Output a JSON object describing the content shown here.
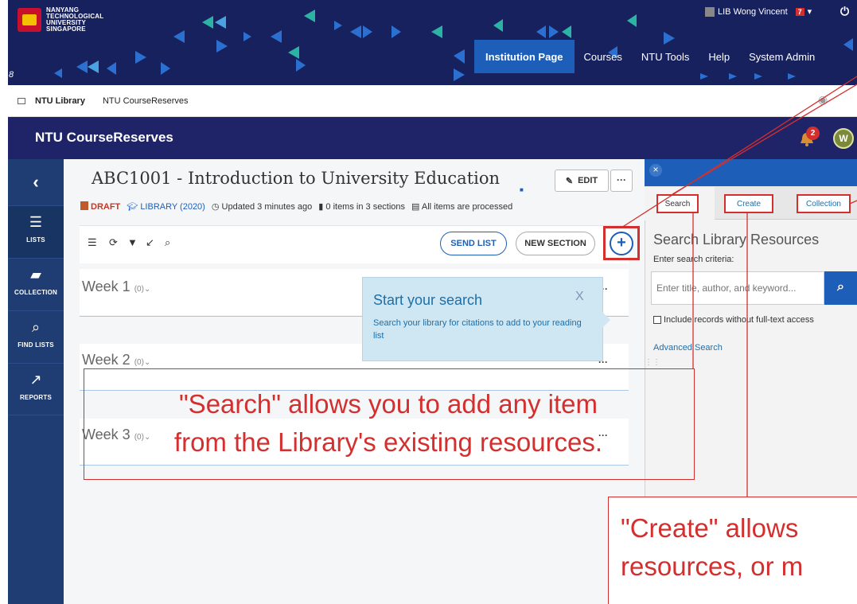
{
  "header": {
    "logo_lines": [
      "NANYANG",
      "TECHNOLOGICAL",
      "UNIVERSITY",
      "SINGAPORE"
    ],
    "nav": [
      {
        "label": "Institution Page",
        "active": true
      },
      {
        "label": "Courses"
      },
      {
        "label": "NTU Tools"
      },
      {
        "label": "Help"
      },
      {
        "label": "System Admin"
      }
    ],
    "user_name": "LIB Wong Vincent",
    "user_badge": "7",
    "edge_glyph": "8"
  },
  "breadcrumb": {
    "item1": "NTU Library",
    "item2": "NTU CourseReserves"
  },
  "appbar": {
    "title": "NTU CourseReserves",
    "notification_count": "2",
    "user_initial": "W"
  },
  "sidebar": {
    "items": [
      {
        "label": "LISTS",
        "icon": "list-icon",
        "active": true
      },
      {
        "label": "COLLECTION",
        "icon": "folder-icon"
      },
      {
        "label": "FIND LISTS",
        "icon": "search-icon"
      },
      {
        "label": "REPORTS",
        "icon": "chart-icon"
      }
    ]
  },
  "course": {
    "title": "ABC1001 - Introduction to University Education",
    "edit_label": "EDIT",
    "more_label": "···",
    "status": "DRAFT",
    "library": "LIBRARY (2020)",
    "updated": "Updated 3 minutes ago",
    "items": "0 items in 3 sections",
    "processed": "All items are processed"
  },
  "toolbar": {
    "send_list": "SEND LIST",
    "new_section": "NEW SECTION",
    "add": "+"
  },
  "weeks": [
    {
      "label": "Week 1",
      "count": "(0)"
    },
    {
      "label": "Week 2",
      "count": "(0)"
    },
    {
      "label": "Week 3",
      "count": "(0)"
    }
  ],
  "tooltip": {
    "title": "Start your search",
    "close": "X",
    "body": "Search your library for citations to add to your reading list"
  },
  "panel": {
    "tabs": [
      "Search",
      "Create",
      "Collection"
    ],
    "title": "Search Library Resources",
    "subtitle": "Enter search criteria:",
    "placeholder": "Enter title, author, and keyword...",
    "checkbox_label": "Include records without full-text access",
    "advanced": "Advanced Search"
  },
  "annotations": {
    "search_text_1": "\"Search\" allows you to add any item",
    "search_text_2": "from the Library's existing resources.",
    "create_text_1": "\"Create\" allows",
    "create_text_2": "resources, or m"
  },
  "colors": {
    "header_bg": "#17215d",
    "appbar_bg": "#1f2367",
    "sidebar_bg": "#1f3d73",
    "accent_blue": "#1d5fb8",
    "annotation_red": "#d32f2f",
    "teal_triangle": "#2bb3a3"
  }
}
